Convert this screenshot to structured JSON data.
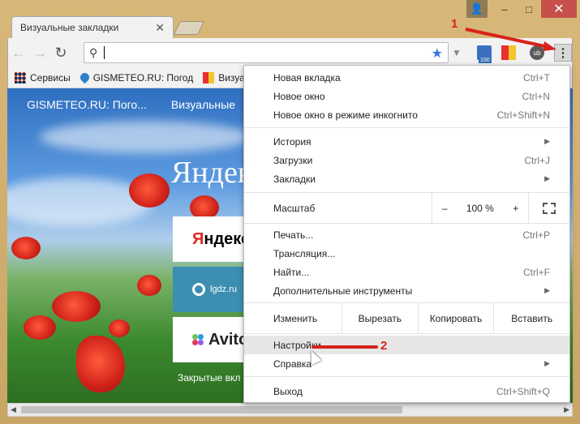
{
  "window": {
    "controls": {
      "user": "👤",
      "minimize": "–",
      "maximize": "□",
      "close": "✕"
    }
  },
  "tab": {
    "title": "Визуальные закладки",
    "close": "✕"
  },
  "toolbar": {
    "back": "←",
    "forward": "→",
    "reload": "↻",
    "search_glyph": "⚲",
    "star": "★",
    "menu": "⋮",
    "badge": "100"
  },
  "bookmarks": [
    {
      "label": "Сервисы",
      "icon": "apps-icon"
    },
    {
      "label": "GISMETEO.RU: Погод",
      "icon": "drop-icon"
    },
    {
      "label": "Визуаль",
      "icon": "flag-icon"
    }
  ],
  "content": {
    "links": [
      "GISMETEO.RU: Пого...",
      "Визуальные"
    ],
    "yandex_big": "Яндекс",
    "tiles": [
      {
        "text_red": "Я",
        "text": "ндекс"
      },
      {
        "text": "lgdz.ru"
      },
      {
        "text": "Avito"
      }
    ],
    "closed": "Закрытые вкл"
  },
  "menu": {
    "new_tab": {
      "label": "Новая вкладка",
      "shortcut": "Ctrl+T"
    },
    "new_window": {
      "label": "Новое окно",
      "shortcut": "Ctrl+N"
    },
    "incognito": {
      "label": "Новое окно в режиме инкогнито",
      "shortcut": "Ctrl+Shift+N"
    },
    "history": {
      "label": "История"
    },
    "downloads": {
      "label": "Загрузки",
      "shortcut": "Ctrl+J"
    },
    "bookmarks": {
      "label": "Закладки"
    },
    "zoom": {
      "label": "Масштаб",
      "minus": "–",
      "value": "100 %",
      "plus": "+"
    },
    "print": {
      "label": "Печать...",
      "shortcut": "Ctrl+P"
    },
    "cast": {
      "label": "Трансляция..."
    },
    "find": {
      "label": "Найти...",
      "shortcut": "Ctrl+F"
    },
    "more_tools": {
      "label": "Дополнительные инструменты"
    },
    "edit": {
      "label": "Изменить",
      "cut": "Вырезать",
      "copy": "Копировать",
      "paste": "Вставить"
    },
    "settings": {
      "label": "Настройки"
    },
    "help": {
      "label": "Справка"
    },
    "exit": {
      "label": "Выход",
      "shortcut": "Ctrl+Shift+Q"
    }
  },
  "annotations": {
    "step1": "1",
    "step2": "2",
    "color": "#d8221b"
  }
}
